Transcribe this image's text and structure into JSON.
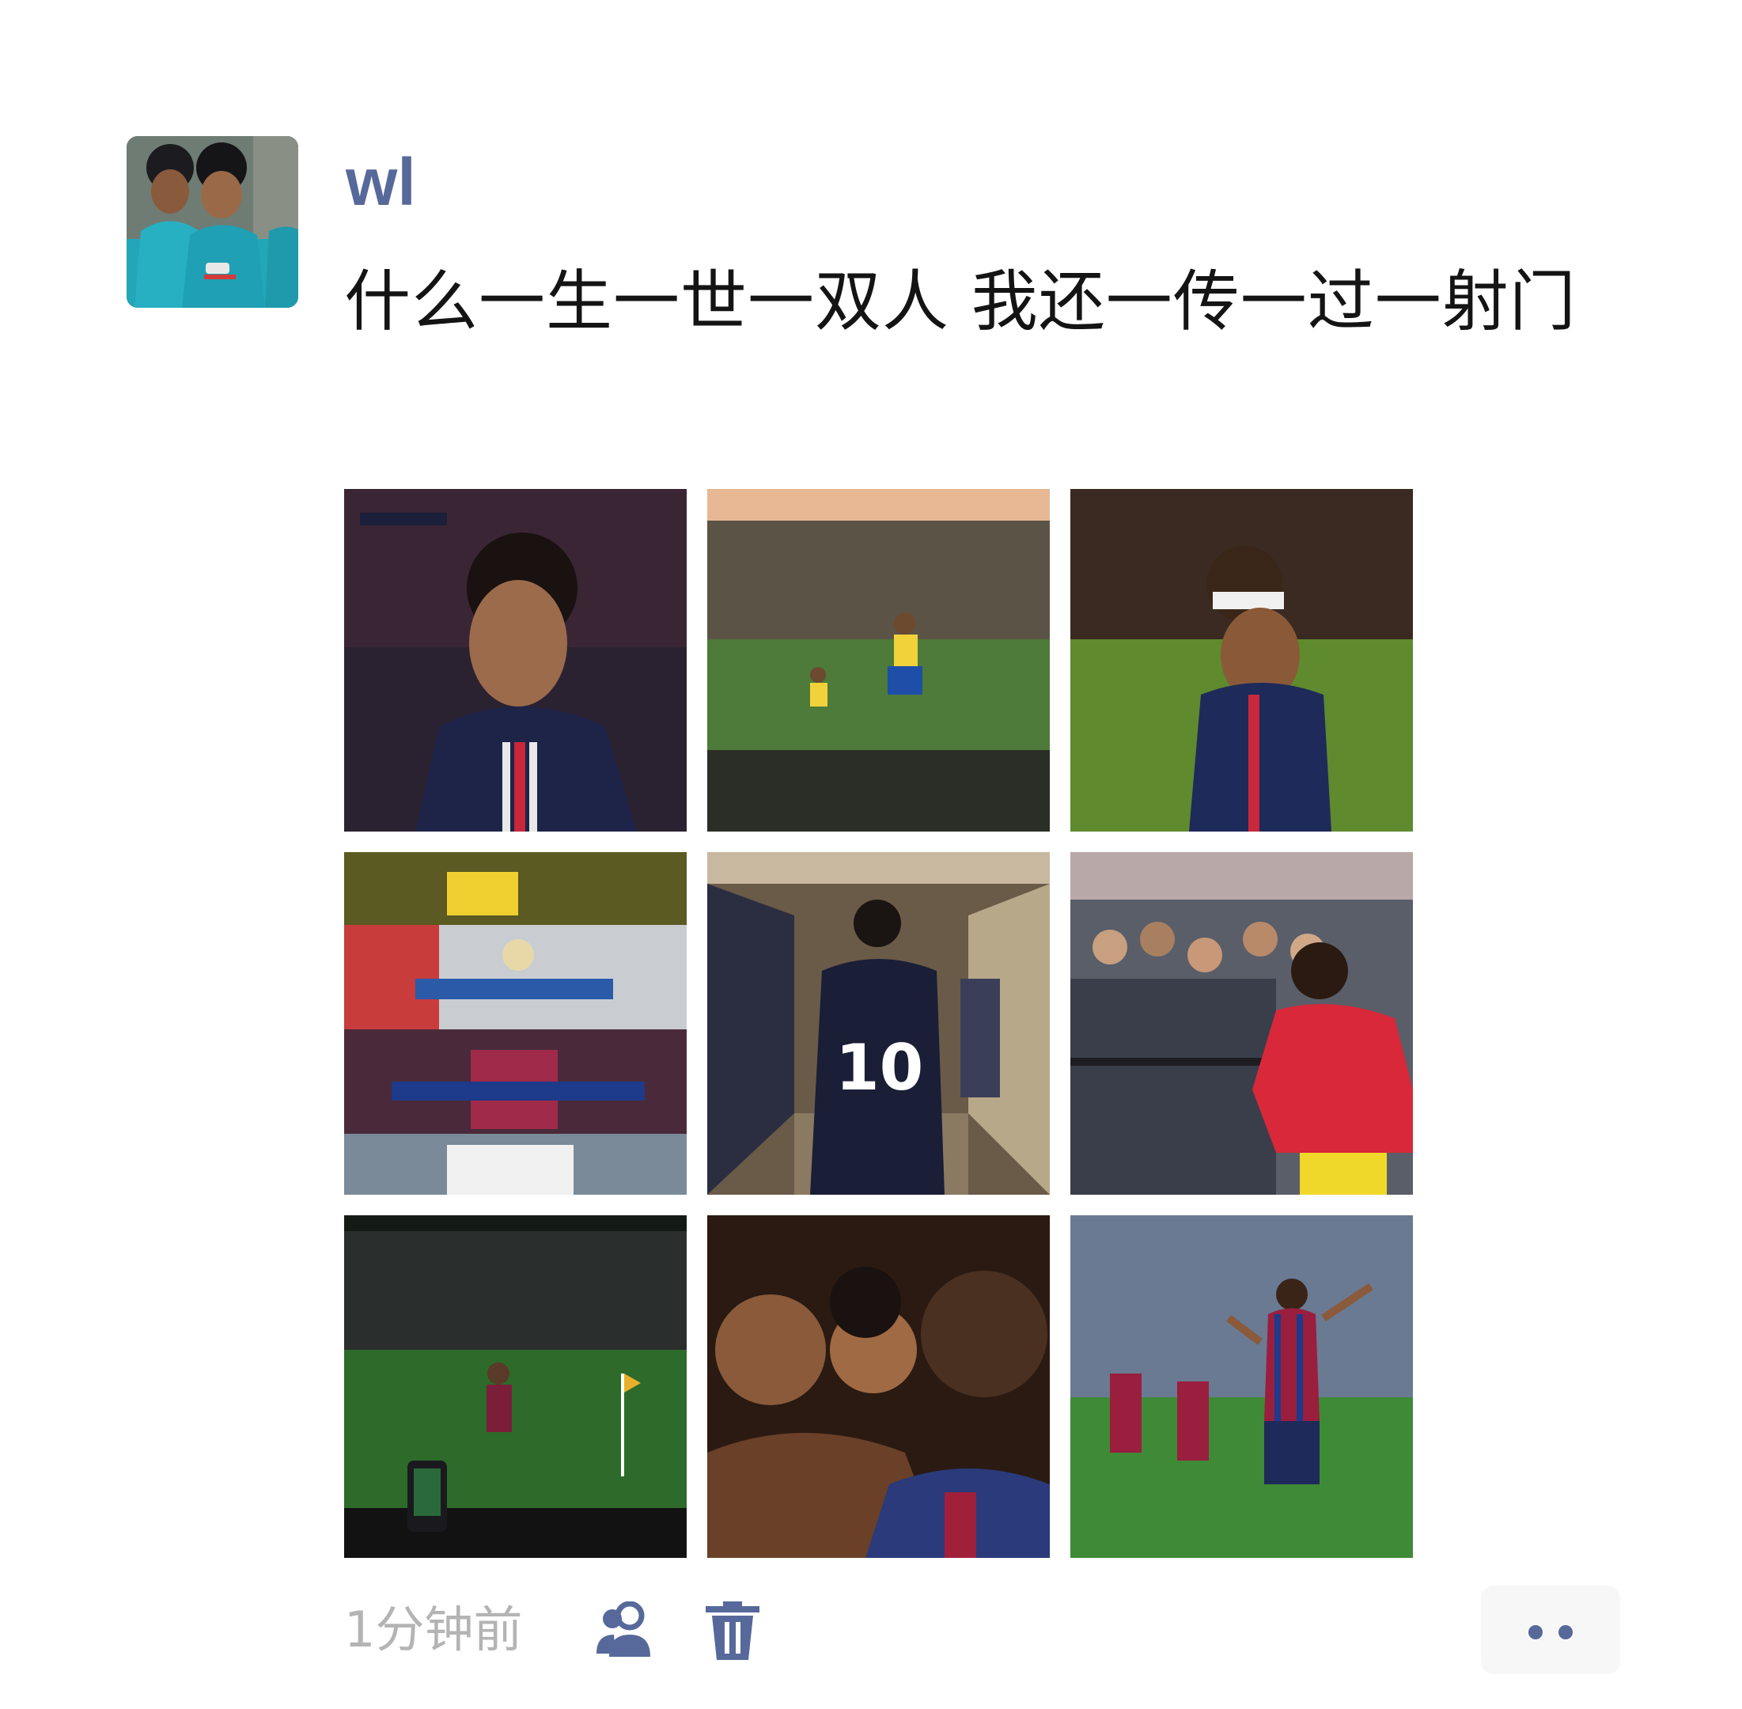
{
  "post": {
    "username": "wl",
    "text": "什么一生一世一双人 我还一传一过一射门",
    "timestamp": "1分钟前"
  },
  "photos": [
    {
      "name": "photo-1"
    },
    {
      "name": "photo-2"
    },
    {
      "name": "photo-3"
    },
    {
      "name": "photo-4"
    },
    {
      "name": "photo-5"
    },
    {
      "name": "photo-6"
    },
    {
      "name": "photo-7"
    },
    {
      "name": "photo-8"
    },
    {
      "name": "photo-9"
    }
  ],
  "icons": {
    "visibility": "people-icon",
    "delete": "trash-icon",
    "more": "more-dots-icon"
  },
  "colors": {
    "accent": "#56699a",
    "text": "#141414",
    "muted": "#b4b4b4"
  }
}
